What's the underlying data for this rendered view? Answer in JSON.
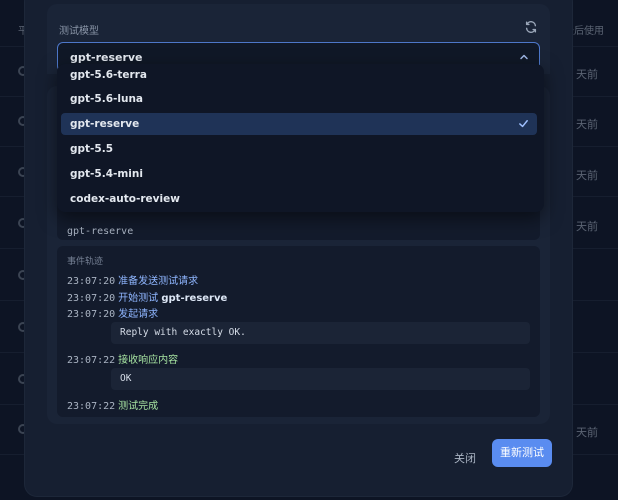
{
  "background": {
    "header_left": "平",
    "header_right": "最后使用",
    "days_label": "天前"
  },
  "modal": {
    "model_label": "测试模型",
    "selected_model": "gpt-reserve",
    "dropdown_options": [
      {
        "label": "gpt-5.6-terra",
        "selected": false
      },
      {
        "label": "gpt-5.6-luna",
        "selected": false
      },
      {
        "label": "gpt-reserve",
        "selected": true
      },
      {
        "label": "gpt-5.5",
        "selected": false
      },
      {
        "label": "gpt-5.4-mini",
        "selected": false
      },
      {
        "label": "codex-auto-review",
        "selected": false
      }
    ],
    "inner_model": "gpt-reserve",
    "events_title": "事件轨迹",
    "events": [
      {
        "time": "23:07:20",
        "msg": "准备发送测试请求"
      },
      {
        "time": "23:07:20",
        "msg": "开始测试",
        "model": "gpt-reserve"
      },
      {
        "time": "23:07:20",
        "msg": "发起请求"
      },
      {
        "code": "Reply with exactly OK."
      },
      {
        "time": "23:07:22",
        "msg": "接收响应内容"
      },
      {
        "code": "OK"
      },
      {
        "time": "23:07:22",
        "msg": "测试完成"
      }
    ],
    "close_label": "关闭",
    "retest_label": "重新测试"
  },
  "colors": {
    "accent": "#5a8cf0",
    "selected_bg": "#1f3357",
    "success": "#a6e3a1",
    "info": "#8fb6ff"
  }
}
